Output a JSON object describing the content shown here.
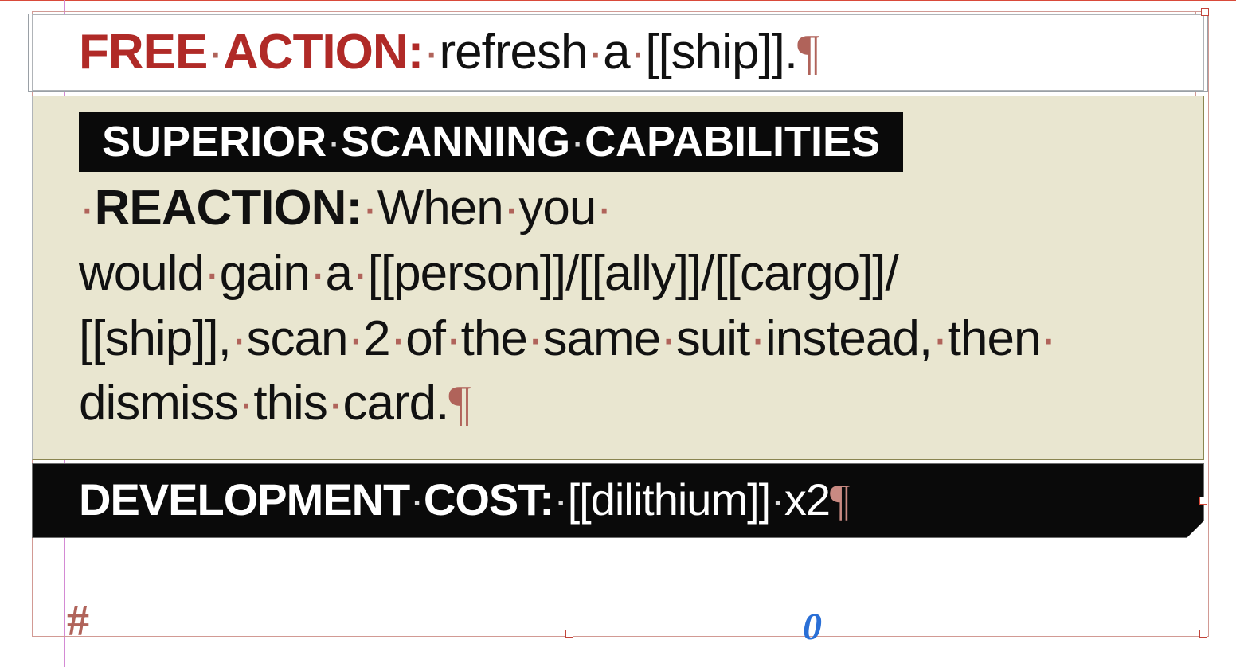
{
  "hidden_chars": {
    "space": "·",
    "paragraph": "¶",
    "frame_break": "#"
  },
  "box1": {
    "label": "FREE",
    "label2": "ACTION:",
    "text_parts": [
      "refresh",
      "a",
      "[[ship]]."
    ]
  },
  "box2": {
    "ability_name_parts": [
      "SUPERIOR",
      "SCANNING",
      "CAPABILITIES"
    ],
    "reaction_label": "REACTION:",
    "text_l1": [
      "When",
      "you"
    ],
    "text_l2": [
      "would",
      "gain",
      "a",
      "[[person]]/[[ally]]/[[cargo]]/"
    ],
    "text_l3": [
      "[[ship]],",
      "scan",
      "2",
      "of",
      "the",
      "same",
      "suit",
      "instead,",
      "then"
    ],
    "text_l4": [
      "dismiss",
      "this",
      "card."
    ]
  },
  "box3": {
    "label_parts": [
      "DEVELOPMENT",
      "COST:"
    ],
    "value_parts": [
      "[[dilithium]]",
      "x2"
    ]
  },
  "overflow_indicator": "0"
}
